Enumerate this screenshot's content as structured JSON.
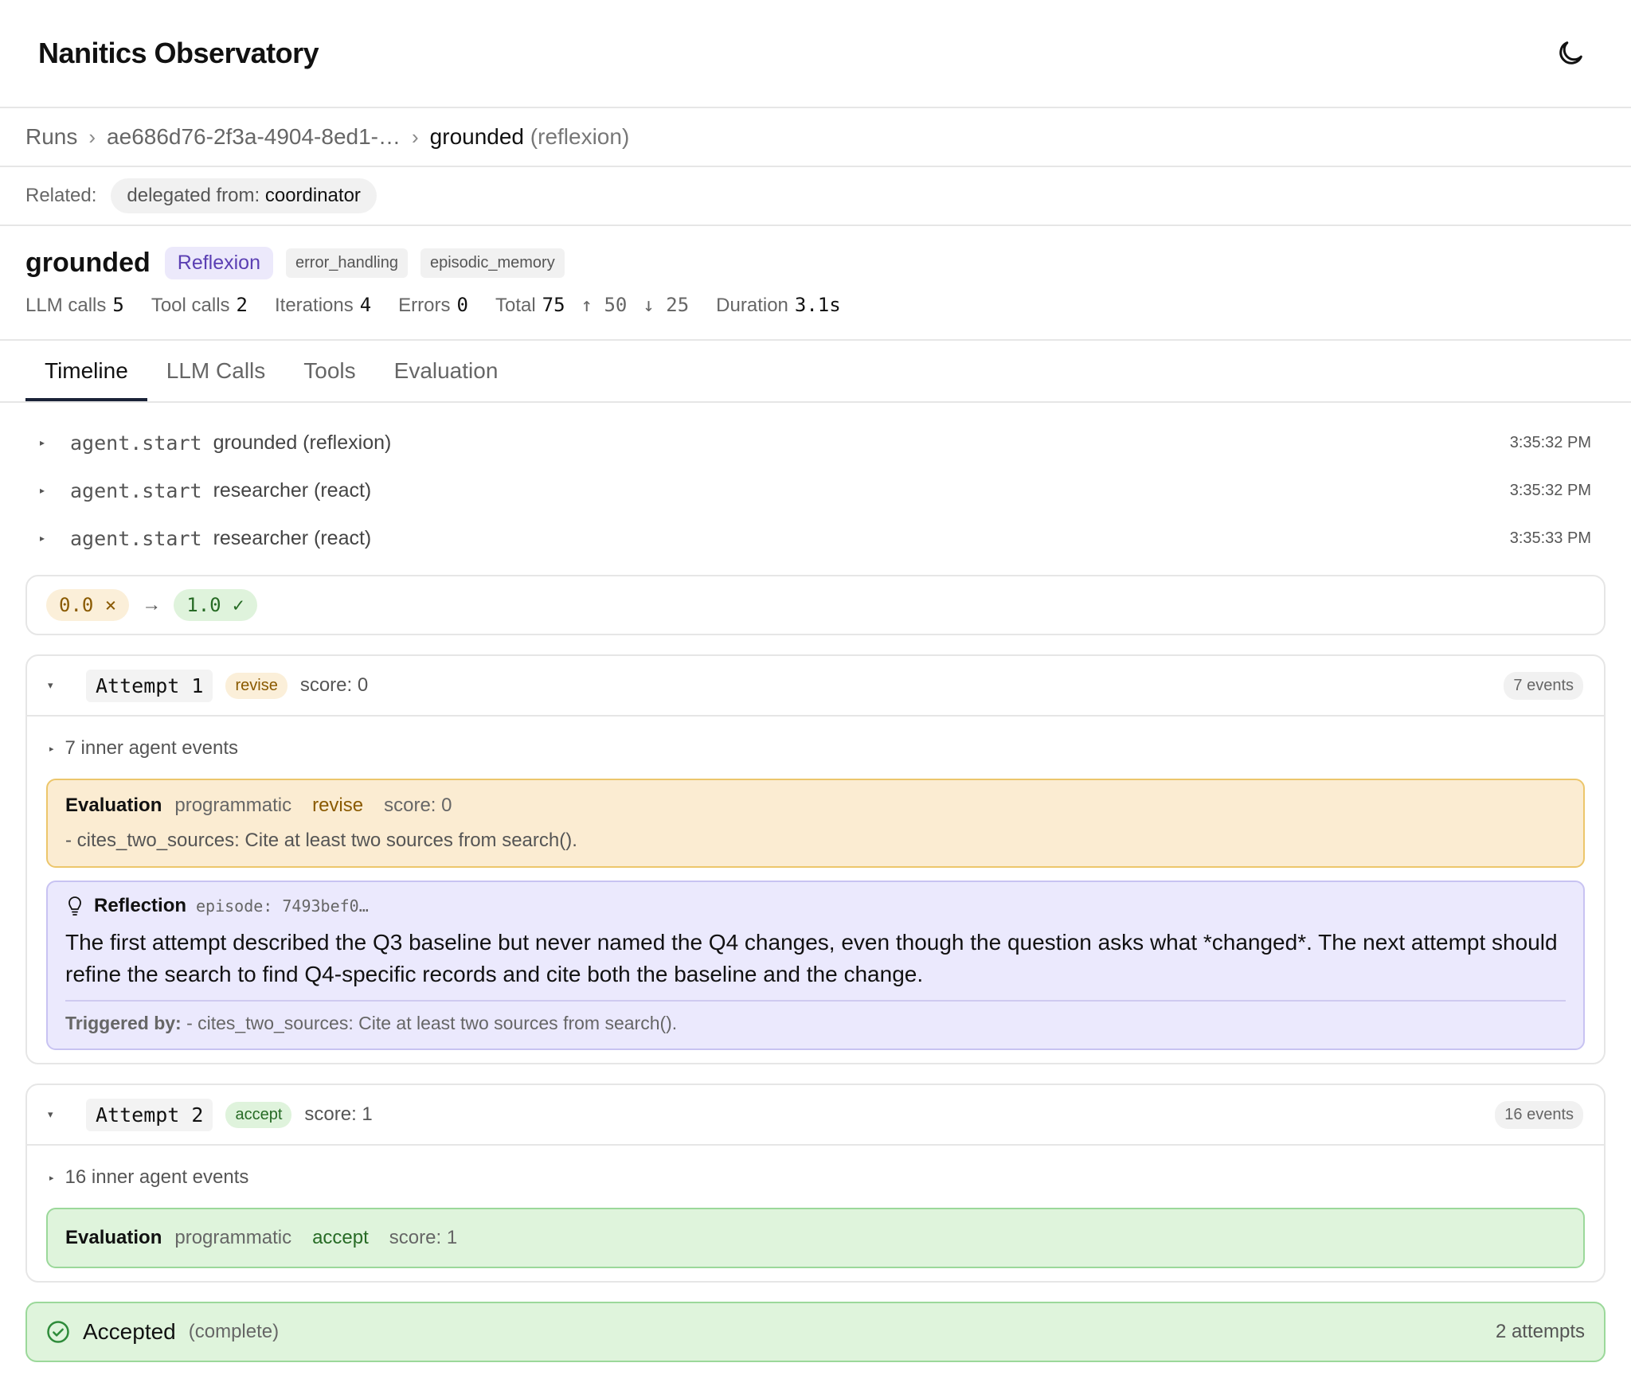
{
  "header": {
    "title": "Nanitics Observatory",
    "theme_icon": "moon-icon"
  },
  "breadcrumb": {
    "root": "Runs",
    "run_id": "ae686d76-2f3a-4904-8ed1-…",
    "current": "grounded",
    "current_sub": "(reflexion)"
  },
  "related": {
    "label": "Related:",
    "chip_prefix": "delegated from:",
    "chip_value": "coordinator"
  },
  "run": {
    "name": "grounded",
    "strategy": "Reflexion",
    "tags": [
      "error_handling",
      "episodic_memory"
    ],
    "stats": {
      "llm_calls_label": "LLM calls",
      "llm_calls": "5",
      "tool_calls_label": "Tool calls",
      "tool_calls": "2",
      "iterations_label": "Iterations",
      "iterations": "4",
      "errors_label": "Errors",
      "errors": "0",
      "total_label": "Total",
      "total": "75",
      "tokens_up": "↑ 50",
      "tokens_down": "↓ 25",
      "duration_label": "Duration",
      "duration": "3.1s"
    }
  },
  "tabs": [
    "Timeline",
    "LLM Calls",
    "Tools",
    "Evaluation"
  ],
  "events": [
    {
      "type": "agent.start",
      "name": "grounded (reflexion)",
      "time": "3:35:32 PM"
    },
    {
      "type": "agent.start",
      "name": "researcher (react)",
      "time": "3:35:32 PM"
    },
    {
      "type": "agent.start",
      "name": "researcher (react)",
      "time": "3:35:33 PM"
    }
  ],
  "score_strip": {
    "from": "0.0 ×",
    "arrow": "→",
    "to": "1.0 ✓"
  },
  "attempts": [
    {
      "label": "Attempt 1",
      "decision": "revise",
      "score": "score: 0",
      "events": "7 events",
      "inner": "7 inner agent events",
      "evaluation": {
        "title": "Evaluation",
        "method": "programmatic",
        "decision": "revise",
        "score": "score: 0",
        "detail": "- cites_two_sources: Cite at least two sources from search()."
      },
      "reflection": {
        "title": "Reflection",
        "episode": "episode: 7493bef0…",
        "text": "The first attempt described the Q3 baseline but never named the Q4 changes, even though the question asks what *changed*. The next attempt should refine the search to find Q4-specific records and cite both the baseline and the change.",
        "trigger_label": "Triggered by:",
        "trigger": "- cites_two_sources: Cite at least two sources from search()."
      }
    },
    {
      "label": "Attempt 2",
      "decision": "accept",
      "score": "score: 1",
      "events": "16 events",
      "inner": "16 inner agent events",
      "evaluation": {
        "title": "Evaluation",
        "method": "programmatic",
        "decision": "accept",
        "score": "score: 1"
      }
    }
  ],
  "final": {
    "label": "Accepted",
    "sub": "(complete)",
    "attempts": "2 attempts"
  },
  "colors": {
    "accent": "#1a2238",
    "revise": "#8a5a00",
    "accept": "#276b25",
    "reflexion": "#5b3fb3"
  }
}
